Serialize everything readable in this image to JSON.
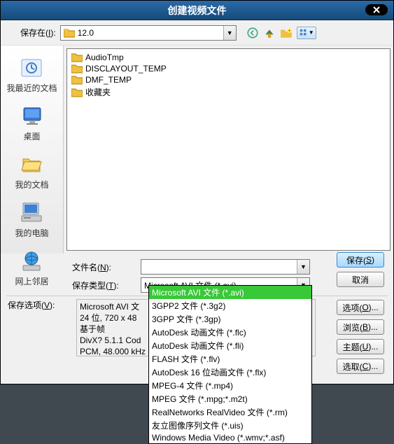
{
  "title": "创建视频文件",
  "saveIn": {
    "label": "保存在(I):",
    "value": "12.0"
  },
  "toolbarIcons": [
    "back-icon",
    "up-icon",
    "new-folder-icon",
    "views-icon"
  ],
  "sidebar": [
    {
      "id": "recent",
      "label": "我最近的文档"
    },
    {
      "id": "desktop",
      "label": "桌面"
    },
    {
      "id": "mydocs",
      "label": "我的文档"
    },
    {
      "id": "mycomputer",
      "label": "我的电脑"
    },
    {
      "id": "network",
      "label": "网上邻居"
    }
  ],
  "files": [
    {
      "name": "AudioTmp"
    },
    {
      "name": "DISCLAYOUT_TEMP"
    },
    {
      "name": "DMF_TEMP"
    },
    {
      "name": "收藏夹"
    }
  ],
  "filenameLabel": "文件名(N):",
  "filenameValue": "",
  "filetypeLabel": "保存类型(T):",
  "filetypeValue": "Microsoft AVI 文件 (*.avi)",
  "optionsLabel": "保存选项(V):",
  "info": {
    "l1": "Microsoft AVI 文",
    "l2": "24 位, 720 x 48",
    "l3": "基于帧",
    "l4": "DivX? 5.1.1 Cod",
    "l5": "PCM, 48.000 kHz"
  },
  "buttons": {
    "save": "保存(S)",
    "cancel": "取消",
    "options": "选项(O)...",
    "browse": "浏览(B)...",
    "subject": "主题(U)...",
    "select": "选取(C)..."
  },
  "dropdown": [
    {
      "text": "Microsoft AVI 文件 (*.avi)",
      "hl": true
    },
    {
      "text": "3GPP2 文件 (*.3g2)"
    },
    {
      "text": "3GPP 文件 (*.3gp)"
    },
    {
      "text": "AutoDesk 动画文件 (*.flc)"
    },
    {
      "text": "AutoDesk 动画文件 (*.fli)"
    },
    {
      "text": "FLASH 文件 (*.flv)"
    },
    {
      "text": "AutoDesk 16 位动画文件 (*.flx)"
    },
    {
      "text": "MPEG-4 文件 (*.mp4)"
    },
    {
      "text": "MPEG 文件 (*.mpg;*.m2t)"
    },
    {
      "text": "RealNetworks RealVideo 文件 (*.rm)"
    },
    {
      "text": "友立图像序列文件 (*.uis)"
    },
    {
      "text": "Windows Media Video (*.wmv;*.asf)"
    }
  ]
}
